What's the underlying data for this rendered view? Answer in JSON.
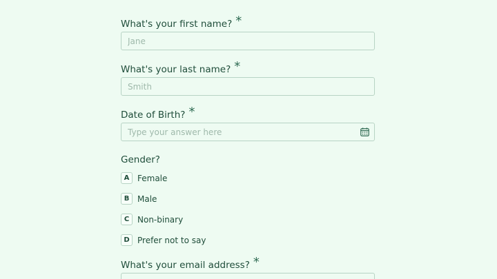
{
  "questions": {
    "first_name": {
      "label": "What's your first name?",
      "required_mark": "*",
      "placeholder": "Jane"
    },
    "last_name": {
      "label": "What's your last name?",
      "required_mark": "*",
      "placeholder": "Smith"
    },
    "dob": {
      "label": "Date of Birth?",
      "required_mark": "*",
      "placeholder": "Type your answer here",
      "icon": "calendar-icon"
    },
    "gender": {
      "label": "Gender?",
      "options": [
        {
          "key": "A",
          "label": "Female"
        },
        {
          "key": "B",
          "label": "Male"
        },
        {
          "key": "C",
          "label": "Non-binary"
        },
        {
          "key": "D",
          "label": "Prefer not to say"
        }
      ]
    },
    "email": {
      "label": "What's your email address?",
      "required_mark": "*"
    }
  },
  "colors": {
    "background": "#eefbf2",
    "text": "#1f4d3a",
    "border": "#b7d3c4",
    "placeholder": "#9fb9ab"
  }
}
